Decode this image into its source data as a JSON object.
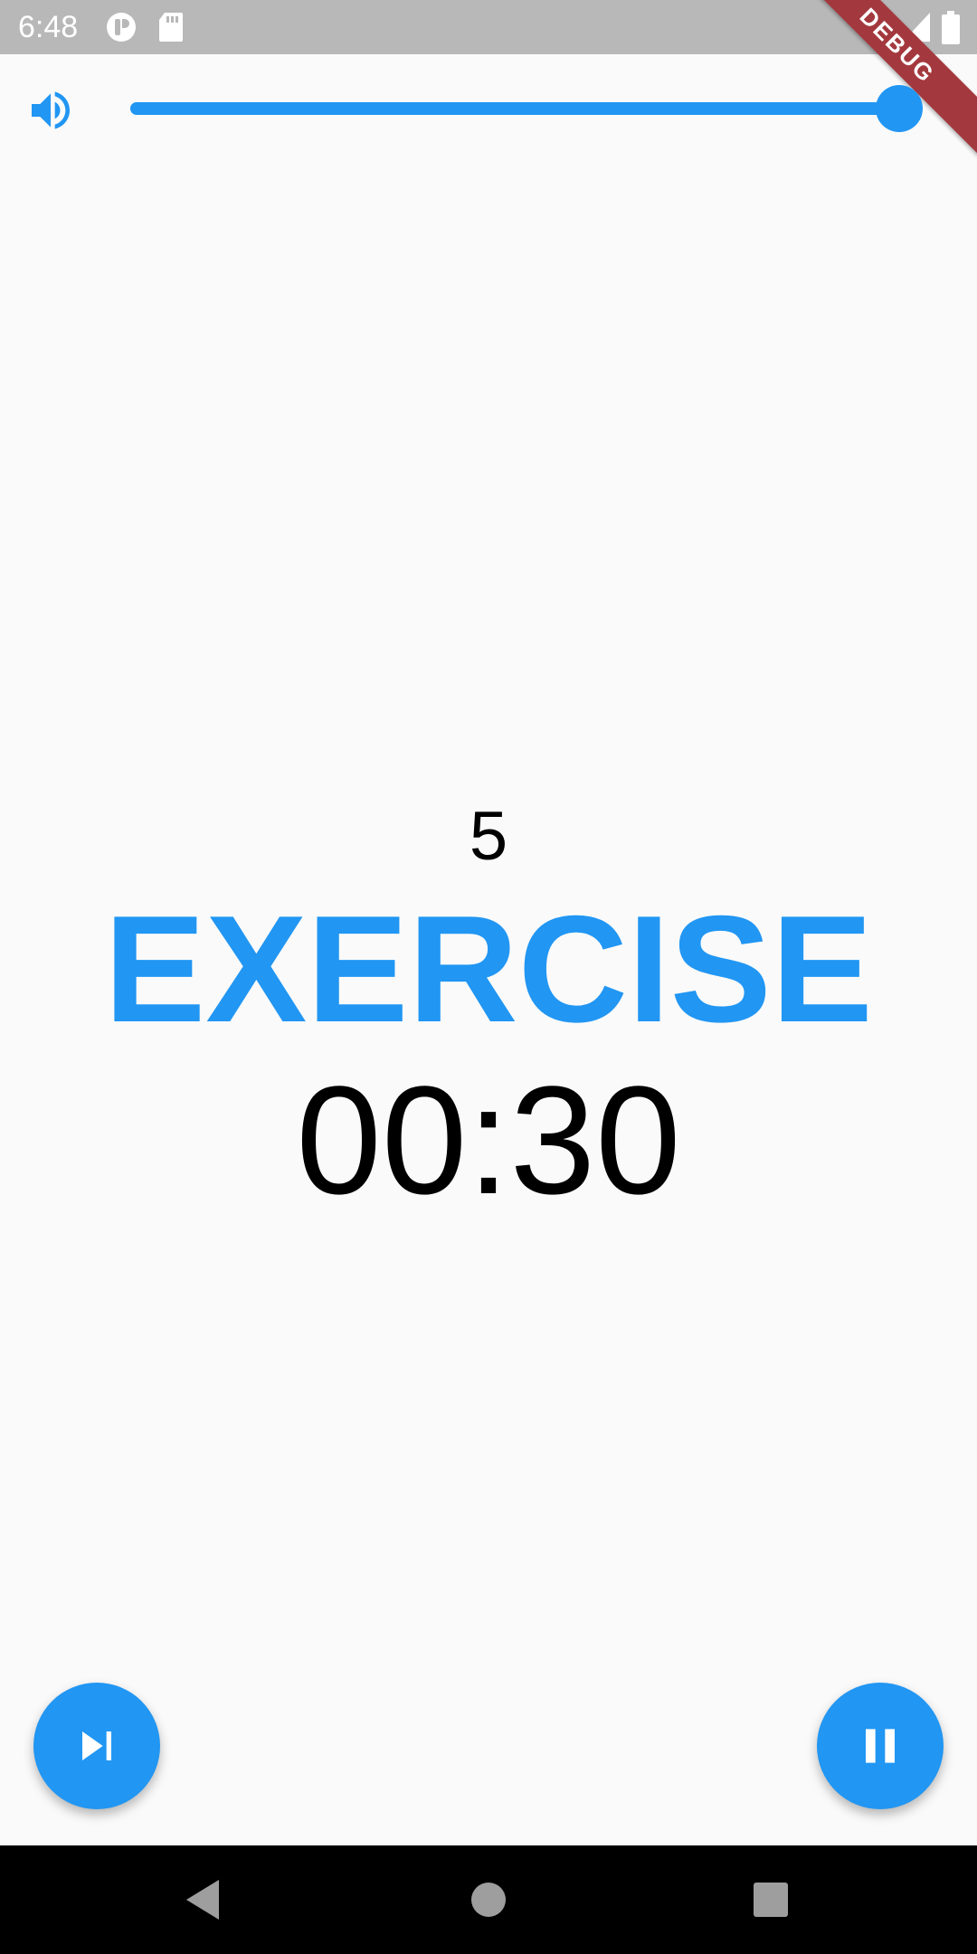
{
  "status_bar": {
    "time": "6:48",
    "icons_left": [
      "app-notification-icon",
      "sd-card-icon"
    ],
    "icons_right": [
      "wifi-icon",
      "signal-icon",
      "battery-icon"
    ],
    "debug_banner": "DEBUG"
  },
  "volume": {
    "icon": "volume-up-icon",
    "level": 1.0
  },
  "workout": {
    "rep_count": "5",
    "phase": "EXERCISE",
    "timer": "00:30"
  },
  "controls": {
    "skip_icon": "skip-next-icon",
    "pause_icon": "pause-icon"
  },
  "navigation": {
    "icons": [
      "back-icon",
      "home-icon",
      "recents-icon"
    ]
  },
  "colors": {
    "accent": "#2196f3",
    "background": "#fafafa",
    "status_bar": "#b8b8b8",
    "debug_ribbon": "#a3393e",
    "nav_bar": "#000000"
  }
}
